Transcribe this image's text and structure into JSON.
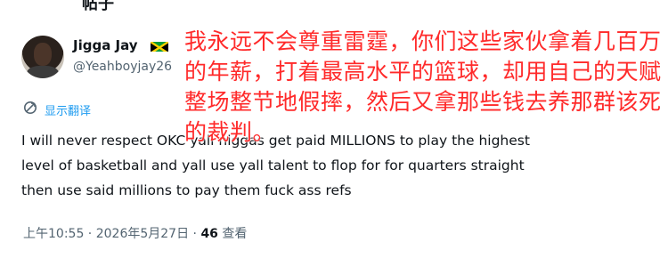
{
  "header": {
    "title_fragment": "帖子"
  },
  "user": {
    "name": "Jigga Jay",
    "handle": "@Yeahboyjay26",
    "flag_icon": "jamaica-flag-icon"
  },
  "translate": {
    "label": "显示翻译",
    "icon": "translate-icon"
  },
  "tweet": {
    "text": "I will never respect OKC yall niggas get paid MILLIONS to play the highest\nlevel of basketball and yall use yall talent to flop for for quarters straight\nthen use said millions to pay them fuck ass refs"
  },
  "overlay": {
    "text": "我永远不会尊重雷霆，你们这些家伙拿着几百万的年薪，打着最高水平的篮球，却用自己的天赋整场整节地假摔，然后又拿那些钱去养那群该死的裁判。"
  },
  "meta": {
    "time": "上午10:55",
    "sep1": " · ",
    "date": "2026年5月27日",
    "sep2": " · ",
    "views": "46",
    "views_label": " 查看"
  },
  "colors": {
    "overlay_red": "#ff2a2a",
    "link_blue": "#1d9bf0",
    "secondary_gray": "#536471"
  }
}
